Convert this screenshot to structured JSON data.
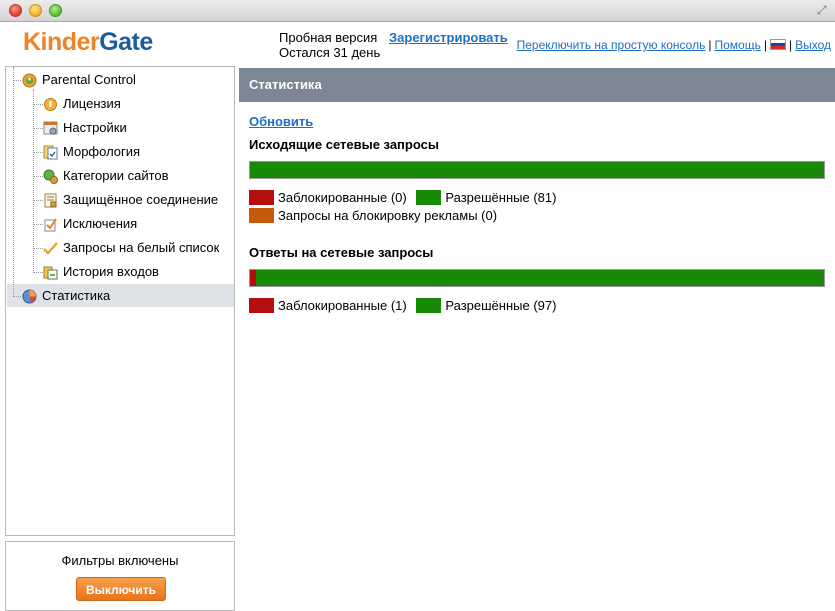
{
  "colors": {
    "blocked": "#b50e0e",
    "allowed": "#188a08",
    "ads": "#c65a0c",
    "accent_orange": "#f0822a",
    "link": "#1f6fc2"
  },
  "logo": {
    "part1": "Kinder",
    "part2": "Gate"
  },
  "header": {
    "trial_line1": "Пробная версия",
    "trial_line2": "Остался 31 день",
    "register": "Зарегистрировать",
    "switch_console": "Переключить на простую консоль",
    "help": "Помощь",
    "exit": "Выход"
  },
  "sidebar": {
    "root": "Parental Control",
    "items": [
      {
        "label": "Лицензия",
        "icon": "license-icon"
      },
      {
        "label": "Настройки",
        "icon": "settings-icon"
      },
      {
        "label": "Морфология",
        "icon": "morphology-icon"
      },
      {
        "label": "Категории сайтов",
        "icon": "categories-icon"
      },
      {
        "label": "Защищённое соединение",
        "icon": "secure-connection-icon"
      },
      {
        "label": "Исключения",
        "icon": "exceptions-icon"
      },
      {
        "label": "Запросы на белый список",
        "icon": "whitelist-icon"
      },
      {
        "label": "История входов",
        "icon": "login-history-icon"
      }
    ],
    "statistics": "Статистика"
  },
  "filters": {
    "status": "Фильтры включены",
    "button": "Выключить"
  },
  "main": {
    "title": "Статистика",
    "refresh": "Обновить",
    "outgoing": {
      "title": "Исходящие сетевые запросы",
      "blocked_label": "Заблокированные (0)",
      "allowed_label": "Разрешённые (81)",
      "ads_label": "Запросы на блокировку рекламы (0)",
      "blocked": 0,
      "allowed": 81,
      "ads": 0
    },
    "responses": {
      "title": "Ответы на сетевые запросы",
      "blocked_label": "Заблокированные (1)",
      "allowed_label": "Разрешённые (97)",
      "blocked": 1,
      "allowed": 97
    }
  }
}
